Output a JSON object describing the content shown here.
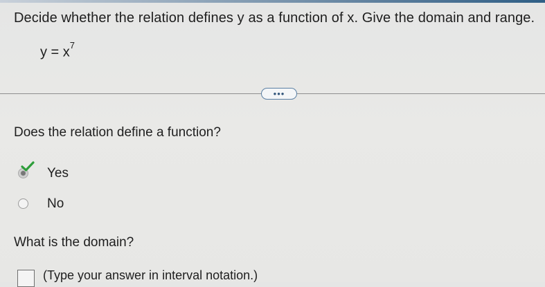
{
  "question": {
    "prompt": "Decide whether the relation defines y as a function of x. Give the domain and range.",
    "equation_base": "y = x",
    "equation_exponent": "7"
  },
  "more_button": {
    "label": "•••",
    "icon": "ellipsis-icon"
  },
  "part_function": {
    "prompt": "Does the relation define a function?",
    "options": [
      {
        "label": "Yes",
        "selected": true,
        "status": "correct"
      },
      {
        "label": "No",
        "selected": false
      }
    ],
    "check_color": "#2e9e3a"
  },
  "part_domain": {
    "prompt": "What is the domain?",
    "answer_value": "",
    "hint": "(Type your answer in interval notation.)"
  },
  "colors": {
    "accent": "#2f5f86",
    "background": "#e7e7e5"
  }
}
